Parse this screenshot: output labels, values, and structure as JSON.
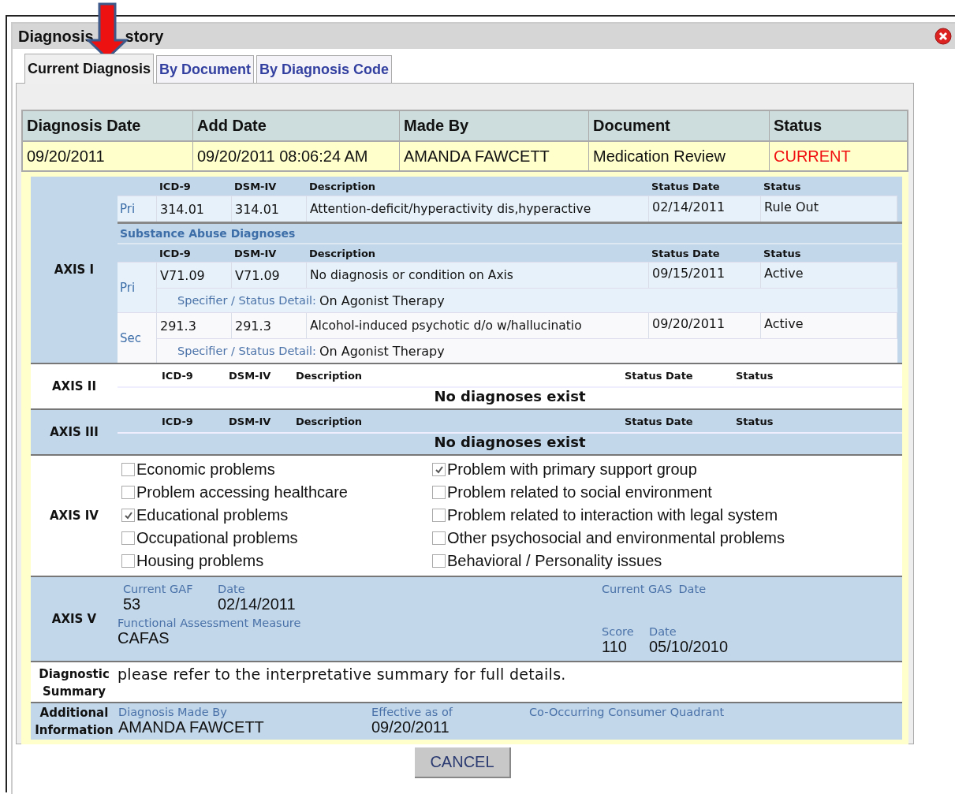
{
  "window": {
    "title_parts": [
      "Diagnosis",
      "story"
    ]
  },
  "tabs": [
    {
      "label": "Current Diagnosis",
      "selected": true
    },
    {
      "label": "By Document",
      "selected": false
    },
    {
      "label": "By Diagnosis Code",
      "selected": false
    }
  ],
  "summary_table": {
    "columns": [
      "Diagnosis Date",
      "Add Date",
      "Made By",
      "Document",
      "Status"
    ],
    "rows": [
      {
        "diagnosis_date": "09/20/2011",
        "add_date": "09/20/2011 08:06:24 AM",
        "made_by": "AMANDA FAWCETT",
        "document": "Medication Review",
        "status": "CURRENT"
      }
    ]
  },
  "axes": [
    {
      "kind": "diagnoses",
      "label": "AXIS I",
      "groups": [
        {
          "columns": [
            "ICD-9",
            "DSM-IV",
            "Description",
            "Status Date",
            "Status"
          ],
          "rows": [
            {
              "rank": "Pri",
              "icd9": "314.01",
              "dsm4": "314.01",
              "description": "Attention-deficit/hyperactivity dis,hyperactive",
              "status_date": "02/14/2011",
              "status": "Rule Out"
            }
          ]
        },
        {
          "heading": "Substance Abuse Diagnoses",
          "columns": [
            "ICD-9",
            "DSM-IV",
            "Description",
            "Status Date",
            "Status"
          ],
          "rows": [
            {
              "rank": "Pri",
              "icd9": "V71.09",
              "dsm4": "V71.09",
              "description": "No diagnosis or condition on Axis",
              "status_date": "09/15/2011",
              "status": "Active",
              "specifier_label": "Specifier / Status Detail:",
              "specifier": "On Agonist Therapy"
            },
            {
              "rank": "Sec",
              "icd9": "291.3",
              "dsm4": "291.3",
              "description": "Alcohol-induced psychotic d/o w/hallucinatio",
              "status_date": "09/20/2011",
              "status": "Active",
              "specifier_label": "Specifier / Status Detail:",
              "specifier": "On Agonist Therapy"
            }
          ]
        }
      ]
    },
    {
      "kind": "empty",
      "label": "AXIS II",
      "columns": [
        "ICD-9",
        "DSM-IV",
        "Description",
        "Status Date",
        "Status"
      ],
      "message": "No diagnoses exist"
    },
    {
      "kind": "empty",
      "label": "AXIS III",
      "columns": [
        "ICD-9",
        "DSM-IV",
        "Description",
        "Status Date",
        "Status"
      ],
      "message": "No diagnoses exist"
    },
    {
      "kind": "checklist",
      "label": "AXIS IV",
      "items": [
        {
          "label": "Economic problems",
          "checked": false
        },
        {
          "label": "Problem with primary support group",
          "checked": true
        },
        {
          "label": "Problem accessing healthcare",
          "checked": false
        },
        {
          "label": "Problem related to social environment",
          "checked": false
        },
        {
          "label": "Educational problems",
          "checked": true
        },
        {
          "label": "Problem related to interaction with legal system",
          "checked": false
        },
        {
          "label": "Occupational problems",
          "checked": false
        },
        {
          "label": "Other psychosocial and environmental problems",
          "checked": false
        },
        {
          "label": "Housing problems",
          "checked": false
        },
        {
          "label": "Behavioral / Personality issues",
          "checked": false
        }
      ]
    },
    {
      "kind": "measures",
      "label": "AXIS V",
      "gaf": {
        "score_label": "Current GAF",
        "date_label": "Date",
        "score": "53",
        "date": "02/14/2011"
      },
      "gas": {
        "score_label": "Current GAS",
        "date_label": "Date"
      },
      "measure": {
        "label": "Functional Assessment Measure",
        "value": "CAFAS"
      },
      "measure_score": {
        "score_label": "Score",
        "date_label": "Date",
        "score": "110",
        "date": "05/10/2010"
      }
    },
    {
      "kind": "text",
      "label": "Diagnostic Summary",
      "text": "please refer to the interpretative summary for full details."
    },
    {
      "kind": "fields",
      "label": "Additional Information",
      "fields": [
        {
          "label": "Diagnosis Made By",
          "value": "AMANDA FAWCETT"
        },
        {
          "label": "Effective as of",
          "value": "09/20/2011"
        },
        {
          "label": "Co-Occurring Consumer Quadrant"
        }
      ]
    }
  ],
  "buttons": [
    "CANCEL"
  ]
}
